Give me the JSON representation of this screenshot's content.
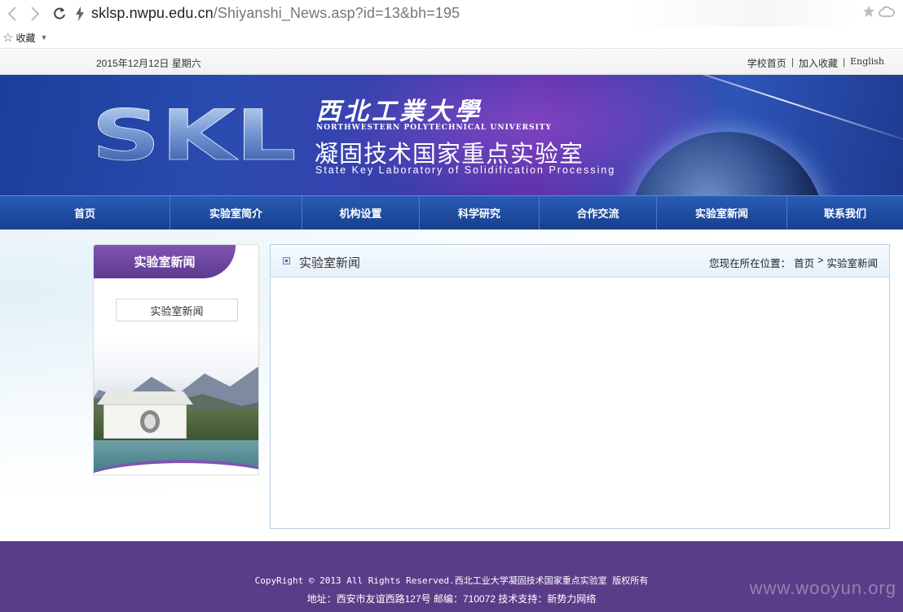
{
  "browser": {
    "url_host": "sklsp.nwpu.edu.cn",
    "url_path": "/Shiyanshi_News.asp?id=13&bh=195",
    "bookmarks_label": "收藏"
  },
  "topbar": {
    "date": "2015年12月12日 星期六",
    "links": [
      "学校首页",
      "加入收藏",
      "English"
    ]
  },
  "banner": {
    "logo_text": "SKL",
    "university_cn": "西北工業大學",
    "university_en": "NORTHWESTERN POLYTECHNICAL UNIVERSITY",
    "lab_cn": "凝固技术国家重点实验室",
    "lab_en": "State Key Laboratory of Solidification Processing"
  },
  "nav": {
    "items": [
      "首页",
      "实验室简介",
      "机构设置",
      "科学研究",
      "合作交流",
      "实验室新闻",
      "联系我们"
    ]
  },
  "sidebar": {
    "title": "实验室新闻",
    "links": [
      "实验室新闻"
    ]
  },
  "main": {
    "title": "实验室新闻",
    "breadcrumb_prefix": "您现在所在位置：",
    "breadcrumb_home": "首页",
    "breadcrumb_sep": ">",
    "breadcrumb_current": "实验室新闻"
  },
  "footer": {
    "copyright": "CopyRight © 2013 All Rights Reserved.西北工业大学凝固技术国家重点实验室 版权所有",
    "address": "地址：西安市友谊西路127号 邮编：710072 技术支持：新势力网络",
    "watermark": "www.wooyun.org"
  },
  "colors": {
    "nav_blue": "#1f4ea3",
    "footer_purple": "#5a3d88",
    "sidebar_purple": "#6e48a0"
  }
}
